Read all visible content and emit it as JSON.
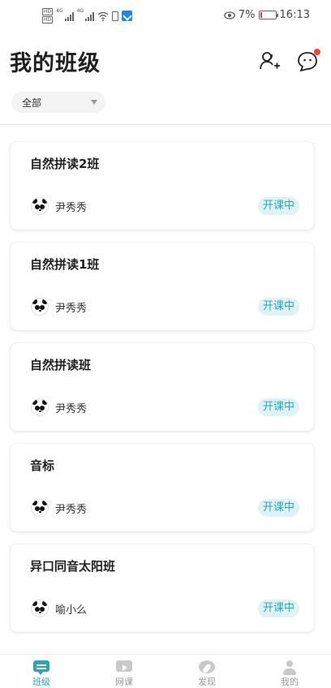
{
  "status_bar": {
    "hd1": "HD",
    "hd2": "HD",
    "net1": "4G",
    "net2": "4G",
    "battery": "7%",
    "time": "16:13"
  },
  "header": {
    "title": "我的班级",
    "add_user_icon": "add-user-icon",
    "message_icon": "message-icon"
  },
  "filter": {
    "label": "全部"
  },
  "classes": [
    {
      "name": "自然拼读2班",
      "teacher": "尹秀秀",
      "status": "开课中"
    },
    {
      "name": "自然拼读1班",
      "teacher": "尹秀秀",
      "status": "开课中"
    },
    {
      "name": "自然拼读班",
      "teacher": "尹秀秀",
      "status": "开课中"
    },
    {
      "name": "音标",
      "teacher": "尹秀秀",
      "status": "开课中"
    },
    {
      "name": "异口同音太阳班",
      "teacher": "喻小么",
      "status": "开课中"
    }
  ],
  "bottom_nav": [
    {
      "label": "班级",
      "icon": "chat-icon",
      "active": true
    },
    {
      "label": "网课",
      "icon": "video-icon",
      "active": false
    },
    {
      "label": "发现",
      "icon": "compass-icon",
      "active": false
    },
    {
      "label": "我的",
      "icon": "user-icon",
      "active": false
    }
  ],
  "colors": {
    "accent": "#2aa6b8",
    "badge_bg": "#dff3f6",
    "notification_dot": "#f44336"
  }
}
